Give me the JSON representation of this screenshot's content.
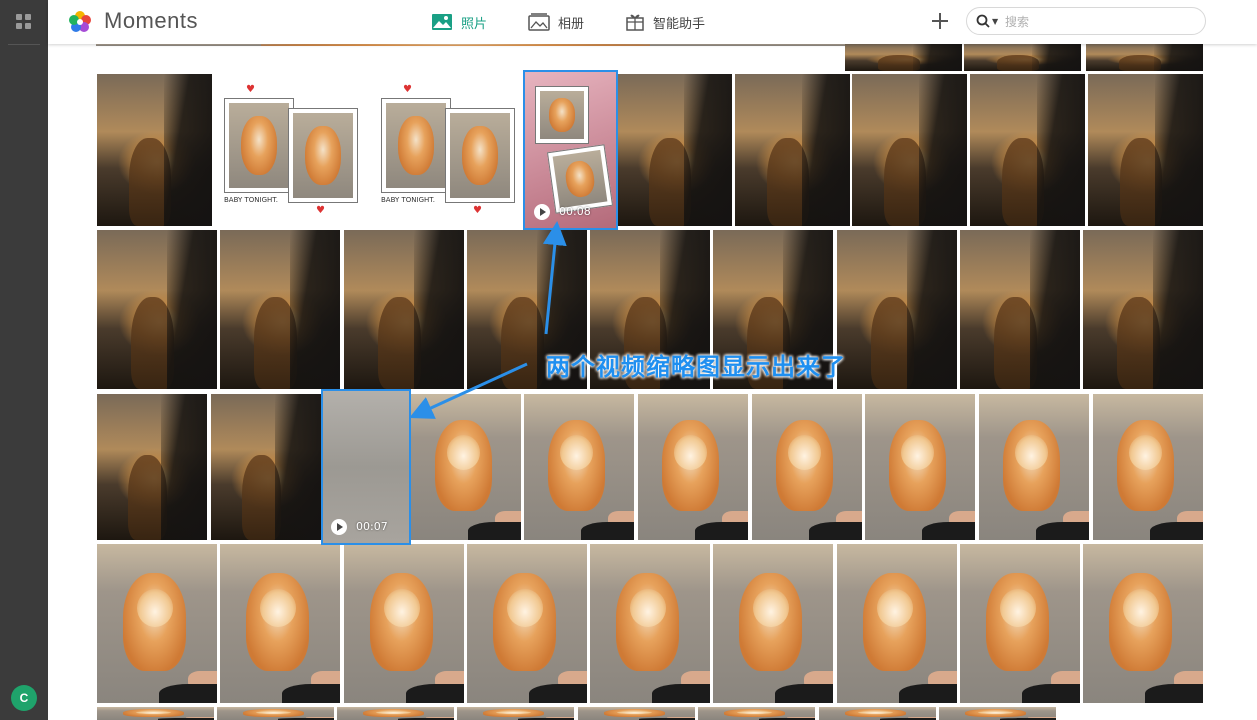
{
  "app": {
    "title": "Moments",
    "avatar_initial": "C"
  },
  "header": {
    "tabs": [
      {
        "label": "照片",
        "icon": "photo-icon",
        "active": true
      },
      {
        "label": "相册",
        "icon": "album-icon",
        "active": false
      },
      {
        "label": "智能助手",
        "icon": "assistant-icon",
        "active": false
      }
    ],
    "add_icon": "plus-icon",
    "search": {
      "placeholder": "搜索",
      "value": ""
    }
  },
  "videos": [
    {
      "duration": "00:08"
    },
    {
      "duration": "00:07"
    }
  ],
  "annotation": {
    "text": "两个视频缩略图显示出来了"
  },
  "polaroid_caption": "BABY TONIGHT.",
  "colors": {
    "accent": "#1aa085",
    "highlight": "#2b8fe8",
    "rail": "#3b3b3b"
  }
}
